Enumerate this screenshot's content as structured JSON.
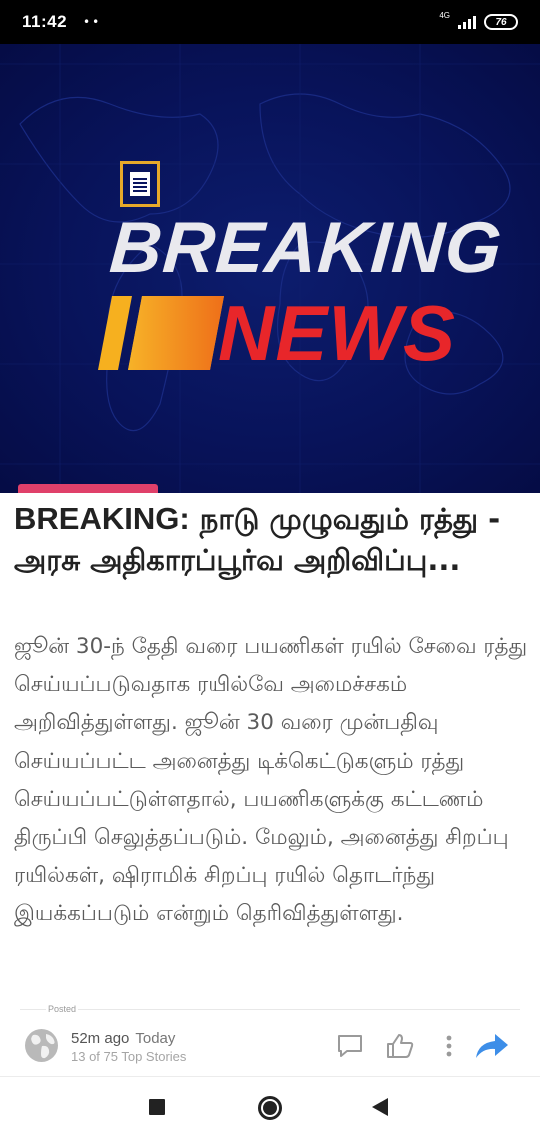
{
  "status_bar": {
    "time": "11:42",
    "dots": "••",
    "network": "4G",
    "battery": "76"
  },
  "hero": {
    "word1": "BREAKING",
    "word2": "NEWS",
    "colors": {
      "background": "#08135a",
      "word1": "#e9e9ee",
      "word2": "#e8262a",
      "bars": "#f39c12",
      "tag": "#e0406a"
    }
  },
  "article": {
    "headline_prefix": "BREAKING:",
    "headline_text": " நாடு முழுவதும் ரத்து - அரசு அதிகாரப்பூர்வ அறிவிப்பு...",
    "summary": "ஜூன் 30-ந் தேதி வரை பயணிகள் ரயில் சேவை ரத்து செய்யப்படுவதாக ரயில்வே அமைச்சகம் அறிவித்துள்ளது. ஜூன் 30 வரை முன்பதிவு செய்யப்பட்ட அனைத்து டிக்கெட்டுகளும் ரத்து செய்யப்பட்டுள்ளதால், பயணிகளுக்கு கட்டணம் திருப்பி செலுத்தப்படும். மேலும், அனைத்து சிறப்பு ரயில்கள், ஷிராமிக் சிறப்பு ரயில் தொடர்ந்து இயக்கப்படும் என்றும் தெரிவித்துள்ளது."
  },
  "meta": {
    "posted_label": "Posted",
    "time_ago": "52m ago",
    "day": "Today",
    "rank": "13 of 75 Top Stories"
  },
  "icons": {
    "comment": "comment-icon",
    "like": "thumbs-up-icon",
    "more": "more-vertical-icon",
    "share": "share-arrow-icon",
    "share_color": "#3d8ee8"
  }
}
